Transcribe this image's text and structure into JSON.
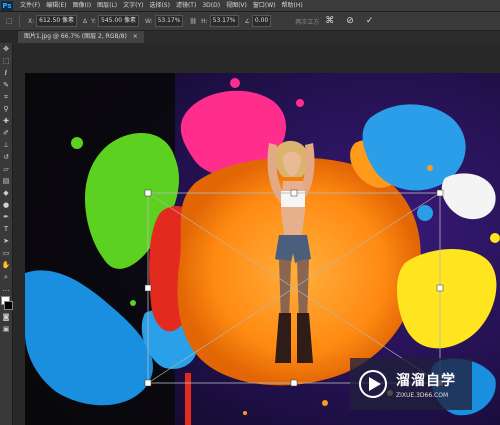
{
  "menu": {
    "logo": "Ps",
    "items": [
      "文件(F)",
      "编辑(E)",
      "图像(I)",
      "图层(L)",
      "文字(Y)",
      "选择(S)",
      "滤镜(T)",
      "3D(D)",
      "视图(V)",
      "窗口(W)",
      "帮助(H)"
    ]
  },
  "options": {
    "x_label": "X:",
    "x_value": "612.50 像素",
    "y_label": "Y:",
    "y_value": "545.00 像素",
    "w_label": "W:",
    "w_value": "53.17%",
    "h_label": "H:",
    "h_value": "53.17%",
    "angle_value": "0.00",
    "interp": "两次立方",
    "cancel_label": "⊘",
    "commit_label": "✓"
  },
  "document": {
    "tab_label": "图片1.jpg @ 66.7% (图层 2, RGB/8)"
  },
  "tools": [
    "move-tool",
    "marquee-tool",
    "lasso-tool",
    "quick-select-tool",
    "crop-tool",
    "eyedropper-tool",
    "healing-tool",
    "brush-tool",
    "stamp-tool",
    "history-brush-tool",
    "eraser-tool",
    "gradient-tool",
    "blur-tool",
    "dodge-tool",
    "pen-tool",
    "type-tool",
    "path-select-tool",
    "shape-tool",
    "hand-tool",
    "zoom-tool",
    "more-tools",
    "colors",
    "quickmask-tool",
    "screen-mode-tool"
  ],
  "watermark": {
    "title": "溜溜自学",
    "subtitle": "ZIXUE.3D66.COM"
  }
}
